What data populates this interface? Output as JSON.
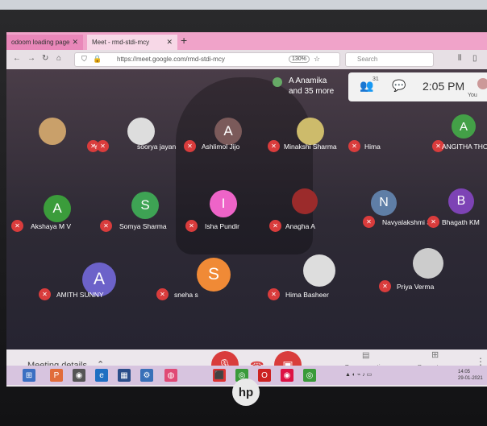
{
  "browser": {
    "tabs": [
      {
        "label": "odoom loading page",
        "close": "✕"
      },
      {
        "label": "Meet - rmd-stdi-mcy",
        "close": "✕"
      }
    ],
    "new_tab": "+",
    "url": "https://meet.google.com/rmd-stdi-mcy",
    "zoom": "130%",
    "search_placeholder": "Search"
  },
  "meet": {
    "presenter": {
      "line1": "A Anamika",
      "line2": "and 35 more"
    },
    "participant_count": "31",
    "time": "2:05 PM",
    "self_label": "You",
    "participants": [
      {
        "name": "You",
        "initial": "",
        "color": "#c9a06a"
      },
      {
        "name": "soorya jayan",
        "initial": "",
        "color": "#ddd"
      },
      {
        "name": "Ashlimol Jijo",
        "initial": "A",
        "color": "#7b5a5a"
      },
      {
        "name": "Minakshi Sharma",
        "initial": "",
        "color": "#cdbb6b"
      },
      {
        "name": "Hima",
        "initial": "",
        "color": ""
      },
      {
        "name": "ANGITHA THOM",
        "initial": "A",
        "color": "#43a047"
      },
      {
        "name": "Akshaya M V",
        "initial": "A",
        "color": "#3b9c3b"
      },
      {
        "name": "Somya Sharma",
        "initial": "S",
        "color": "#3ea354"
      },
      {
        "name": "Isha Pundir",
        "initial": "I",
        "color": "#ee64c8"
      },
      {
        "name": "Anagha A",
        "initial": "",
        "color": "#9b2b2b"
      },
      {
        "name": "Navyalakshmi S",
        "initial": "N",
        "color": "#5f7ea6"
      },
      {
        "name": "Bhagath KM",
        "initial": "B",
        "color": "#7d43b5"
      },
      {
        "name": "AMITH SUNNY",
        "initial": "A",
        "color": "#6c62c9"
      },
      {
        "name": "sneha s",
        "initial": "S",
        "color": "#f08a36"
      },
      {
        "name": "Hima Basheer",
        "initial": "",
        "color": "#ddd"
      },
      {
        "name": "Priya Verma",
        "initial": "",
        "color": "#ccc"
      }
    ],
    "bottom": {
      "details": "Meeting details",
      "captions": "Turn on captions",
      "present": "Present now"
    }
  },
  "laptop": {
    "brand": "hp"
  },
  "taskbar": {
    "date_line": "29-01-2021",
    "time_line": "14:05"
  },
  "colors": {
    "mic_off": "#d93c3c",
    "tab_strip": "#f0a3c9",
    "control_bar": "#ece7ec"
  }
}
